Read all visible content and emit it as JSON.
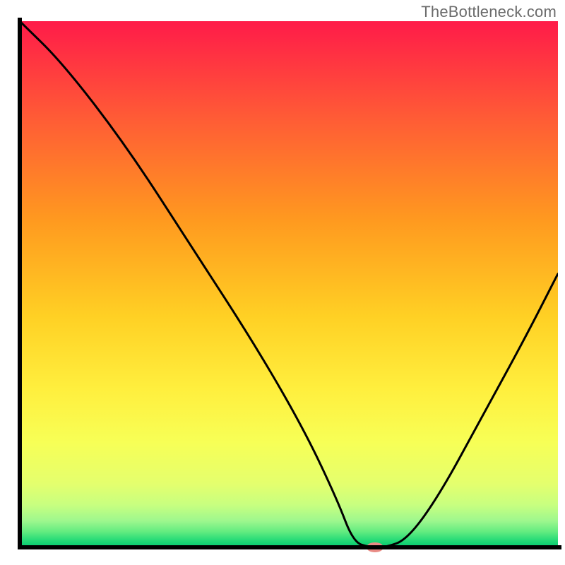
{
  "attribution": "TheBottleneck.com",
  "chart_data": {
    "type": "line",
    "title": "",
    "xlabel": "",
    "ylabel": "",
    "x_range": [
      0,
      100
    ],
    "y_range": [
      0,
      100
    ],
    "series": [
      {
        "name": "bottleneck-curve",
        "x": [
          0,
          8,
          20,
          32,
          44,
          53,
          59,
          62,
          65,
          68,
          72,
          78,
          86,
          94,
          100
        ],
        "y": [
          100,
          92,
          76,
          57,
          38,
          22,
          9,
          1,
          0,
          0,
          1.5,
          10,
          25,
          40,
          52
        ],
        "color": "#000000",
        "stroke_width": 3
      }
    ],
    "marker": {
      "name": "optimum",
      "x": 66,
      "y": 0,
      "fill": "#e98b85",
      "rx": 12,
      "ry": 7
    },
    "background_gradient": {
      "top_color": "#ff1b49",
      "mid_colors": [
        "#ff6a2f",
        "#ffb319",
        "#ffe642",
        "#f6ff5a",
        "#e1ff72"
      ],
      "bottom_band_colors": [
        "#bfff85",
        "#8cf79a",
        "#35e27b",
        "#00c86e"
      ],
      "bottom_band_height_pct": 8
    },
    "axes": {
      "stroke": "#000000",
      "stroke_width": 6
    }
  }
}
